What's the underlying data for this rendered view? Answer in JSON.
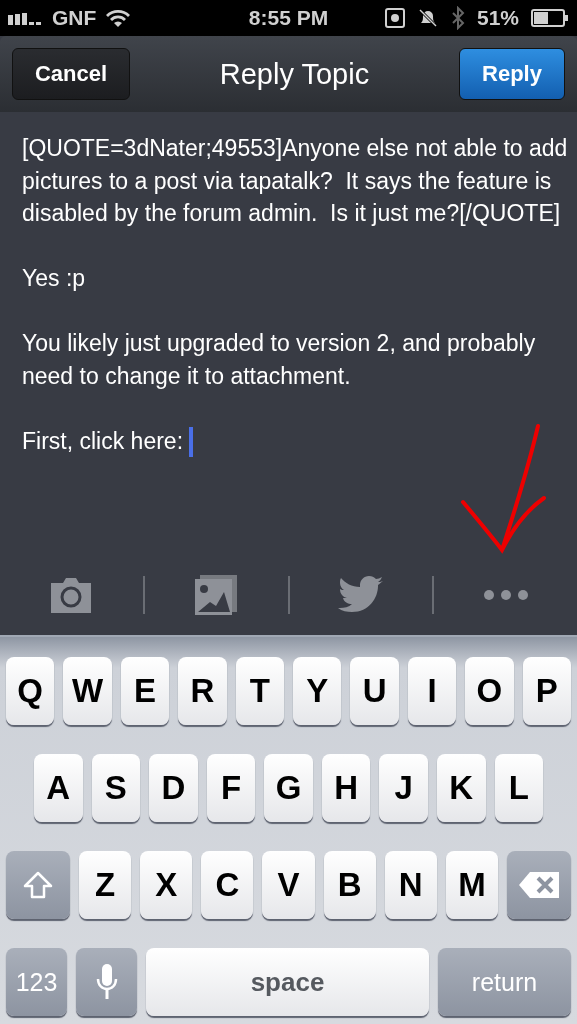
{
  "status_bar": {
    "carrier": "GNF",
    "time": "8:55 PM",
    "battery": "51%"
  },
  "nav_bar": {
    "cancel": "Cancel",
    "title": "Reply Topic",
    "reply": "Reply"
  },
  "body": {
    "paragraphs": [
      "[QUOTE=3dNater;49553]Anyone else not able to add pictures to a post via tapatalk?  It says the feature is disabled by the forum admin.  Is it just me?[/QUOTE]",
      "Yes :p",
      "You likely just upgraded to version 2, and probably need to change it to attachment.",
      "First, click here: "
    ]
  },
  "toolbar": [
    {
      "kind": "camera"
    },
    {
      "kind": "photos"
    },
    {
      "kind": "twitter"
    },
    {
      "kind": "more"
    }
  ],
  "keyboard": {
    "rows": [
      {
        "keys": [
          {
            "kind": "letter",
            "label": "Q"
          },
          {
            "kind": "letter",
            "label": "W"
          },
          {
            "kind": "letter",
            "label": "E"
          },
          {
            "kind": "letter",
            "label": "R"
          },
          {
            "kind": "letter",
            "label": "T"
          },
          {
            "kind": "letter",
            "label": "Y"
          },
          {
            "kind": "letter",
            "label": "U"
          },
          {
            "kind": "letter",
            "label": "I"
          },
          {
            "kind": "letter",
            "label": "O"
          },
          {
            "kind": "letter",
            "label": "P"
          }
        ]
      },
      {
        "keys": [
          {
            "kind": "letter",
            "label": "A"
          },
          {
            "kind": "letter",
            "label": "S"
          },
          {
            "kind": "letter",
            "label": "D"
          },
          {
            "kind": "letter",
            "label": "F"
          },
          {
            "kind": "letter",
            "label": "G"
          },
          {
            "kind": "letter",
            "label": "H"
          },
          {
            "kind": "letter",
            "label": "J"
          },
          {
            "kind": "letter",
            "label": "K"
          },
          {
            "kind": "letter",
            "label": "L"
          }
        ]
      },
      {
        "keys": [
          {
            "kind": "shift"
          },
          {
            "kind": "letter",
            "label": "Z"
          },
          {
            "kind": "letter",
            "label": "X"
          },
          {
            "kind": "letter",
            "label": "C"
          },
          {
            "kind": "letter",
            "label": "V"
          },
          {
            "kind": "letter",
            "label": "B"
          },
          {
            "kind": "letter",
            "label": "N"
          },
          {
            "kind": "letter",
            "label": "M"
          },
          {
            "kind": "delete"
          }
        ]
      }
    ],
    "bottom_row": {
      "numbers": "123",
      "space": "space",
      "return": "return"
    }
  }
}
